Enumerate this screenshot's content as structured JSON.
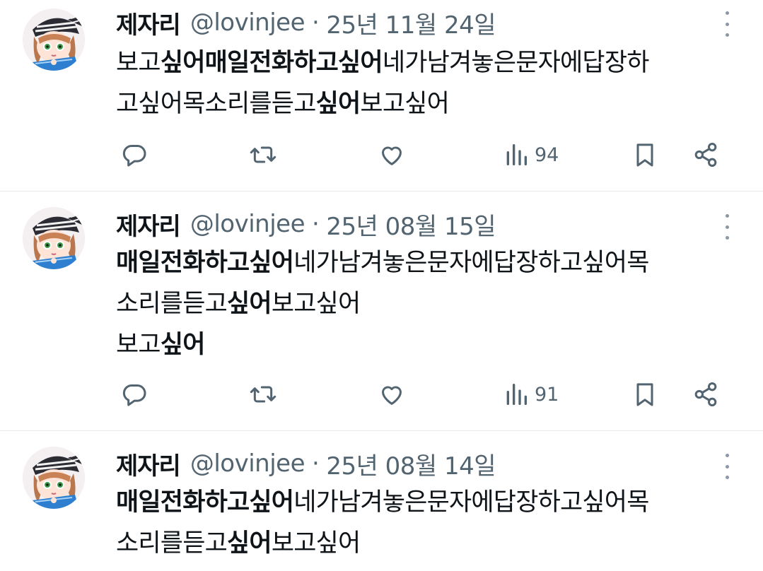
{
  "tweets": [
    {
      "name": "제자리",
      "handle": "@lovinjee",
      "separator": "·",
      "date": "25년 11월 24일",
      "lines": [
        [
          {
            "t": "보고",
            "b": false
          },
          {
            "t": "싶어매일전화하고싶어",
            "b": true
          },
          {
            "t": "네가남겨놓은문자에답장하",
            "b": false
          }
        ],
        [
          {
            "t": "고싶어목소리를듣고",
            "b": false
          },
          {
            "t": "싶어",
            "b": true
          },
          {
            "t": "보고싶어",
            "b": false
          }
        ]
      ],
      "views": "94"
    },
    {
      "name": "제자리",
      "handle": "@lovinjee",
      "separator": "·",
      "date": "25년 08월 15일",
      "lines": [
        [
          {
            "t": "매일전화하고싶어",
            "b": true
          },
          {
            "t": "네가남겨놓은문자에답장하고싶어목",
            "b": false
          }
        ],
        [
          {
            "t": "소리를듣고",
            "b": false
          },
          {
            "t": "싶어",
            "b": true
          },
          {
            "t": "보고싶어",
            "b": false
          }
        ],
        [
          {
            "t": "보고",
            "b": false
          },
          {
            "t": "싶어",
            "b": true
          }
        ]
      ],
      "views": "91"
    },
    {
      "name": "제자리",
      "handle": "@lovinjee",
      "separator": "·",
      "date": "25년 08월 14일",
      "lines": [
        [
          {
            "t": "매일전화하고싶어",
            "b": true
          },
          {
            "t": "네가남겨놓은문자에답장하고싶어목",
            "b": false
          }
        ],
        [
          {
            "t": "소리를듣고",
            "b": false
          },
          {
            "t": "싶어",
            "b": true
          },
          {
            "t": "보고싶어",
            "b": false
          }
        ]
      ],
      "views": ""
    }
  ],
  "icons": {
    "reply": "reply-icon",
    "repost": "repost-icon",
    "like": "heart-icon",
    "views": "views-icon",
    "bookmark": "bookmark-icon",
    "share": "share-icon",
    "more": "more-vertical-icon"
  },
  "colors": {
    "text": "#0f1419",
    "secondary": "#536471",
    "divider": "#e7e9ea"
  }
}
